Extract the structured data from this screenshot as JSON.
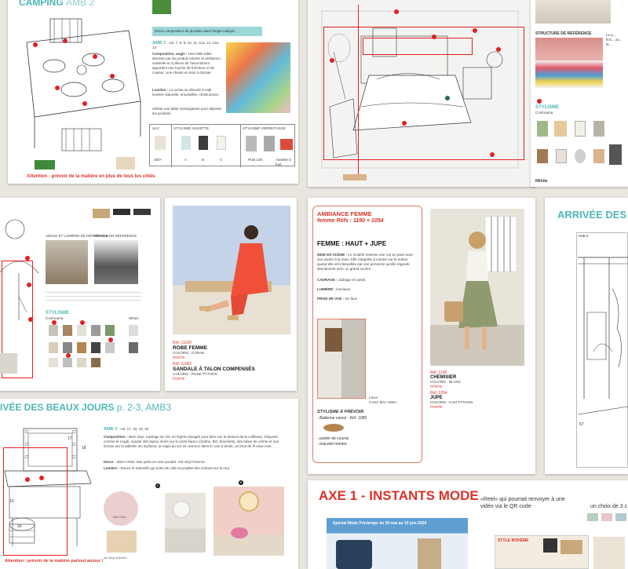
{
  "p1": {
    "title": "CAMPING",
    "title_suffix": "AMB 2",
    "banner": "Décor composition de produits dans l'angle indiqué",
    "amb_label": "AMB 2",
    "amb_vol": "- vol. 7, 8, 9, 10, 11, 11a, 12, 12a, 13",
    "composition_label": "Composition, angle :",
    "composition_text": "Une belle table dressée par du produit colorée et ambiance, vaisselle et 4 pièces de l'assortiment apportent une touche de fraîcheur et de couleur. Une chaise en bois à dossier.",
    "lumiere_label": "Lumière :",
    "lumiere_text": "La scène se déroule à midi, lumière naturelle, ensoleillée, chaleureuse.",
    "note": "Utiliser une table rectangulaire pour déposer les produits.",
    "warning": "Attention : prévoir de la matière en plus de tous les côtés",
    "table_headers": [
      "SAC",
      "STYLISME ASSIETTE",
      "STYLISME VERRE/TASSE"
    ],
    "table_values": [
      "300+",
      "A",
      "B",
      "C",
      "PUB 239",
      "Assiette à fruit"
    ]
  },
  "p2": {
    "struct_label": "STRUCTURE DE RÉFÉRENCE",
    "side_text": "Le p... fich... au... lit...",
    "stylisme_label": "STYLISME",
    "stylisme_sub": "Conforama",
    "nfinite_label": "Nfinite"
  },
  "p3": {
    "ref_label": "ANGLE ET LUMIÈRE DE RÉFÉRENCE",
    "structure_label": "RÉGION DE RÉFÉRENCE",
    "stylisme_label": "STYLISME",
    "stylisme_sub": "Conforama",
    "wholo_label": "Wholo"
  },
  "p4": {
    "product1_ref": "Réf. 11190",
    "product1_name": "ROBE FEMME",
    "product1_colors": "COLORIS : CORAIL",
    "product1_tag": "PORTÉ",
    "product2_ref": "Réf. 11002",
    "product2_name": "SANDALE À TALON COMPENSÉS",
    "product2_colors": "COLORIS : ROSE PYTHON",
    "product2_tag": "PORTÉ"
  },
  "p5": {
    "title": "AMBIANCE FEMME",
    "refs": "femme Réfs : 1190 + 1054",
    "heading": "FEMME : HAUT + JUPE",
    "mise_label": "MISE EN SCÈNE :",
    "mise_text": "Le modèle traverse une rue en pavé avec son panier à la main. Elle s'apprête à monter sur le trottoir quand elle est interpellée par une personne qu'elle regarde directement avec un grand sourire.",
    "cadrage_label": "CADRAGE :",
    "cadrage_text": "cadrage en pieds",
    "lumiere_label": "LUMIÈRE :",
    "lumiere_text": "lumineux",
    "prise_label": "PRISE DE VUE :",
    "prise_text": "De face",
    "stylisme_label": "STYLISME À PRÉVOIR",
    "stylisme_item1": "- Ballerine camel : Réf. 1085",
    "stylisme_item2": "- panier de course",
    "stylisme_item3": "- bracelet montre",
    "photo_label": "Lieux :",
    "photo_place": "CASC BAY AREA",
    "product1_ref": "Réf. 1190",
    "product1_name": "CHEMISIER",
    "product1_colors": "COLORIS : BLANC",
    "product1_tag": "PORTÉ",
    "product2_ref": "Réf. 1054",
    "product2_name": "JUPE",
    "product2_colors": "COLORIS : KAKI PYTHON",
    "product2_tag": "PORTÉ"
  },
  "p6": {
    "title": "ARRIVÉE DES",
    "amb_label": "AMB 8",
    "number": "67"
  },
  "p7": {
    "title": "IVÉE DES BEAUX JOURS",
    "title_pages": "p. 2-3, AMB3",
    "amb_label": "AMB 3",
    "amb_vol": "- vol. 17, 18, 19, 20",
    "composition_label": "Composition :",
    "composition_text": "Idem insp. Cadrage de 3/4, en légère plongée pour bien voir le dessus de la coiffeuse. Disposer comme le rough. Ajouter des bijoux dorés sur le porte-bijoux (chaîne, BO, bracelets), des tubes de crème et une brosse sur la tablette. En stylisme, un tapis au sol. En amorce dans le coin à droite, un bout de fil vase rose.",
    "decor_label": "Décor :",
    "decor_text": "Idem Amb2. Mur peint en rose poudré. Sol vinyl chevron.",
    "lumiere_label": "Lumière :",
    "lumiere_text": "Douce et naturelle qui entre de côté et projette des ombres sur le mur.",
    "swatch1_label": "RAL1164",
    "swatch2_label": "sol vinyl chevron",
    "warning": "Attention : prévoir de la matière partout autour !",
    "num_17": "17",
    "num_18": "18",
    "num_19": "19",
    "num_20": "20",
    "marker_a": "A",
    "marker_b": "B"
  },
  "p8": {
    "title": "AXE 1 - INSTANTS MODE",
    "promo_text": "Spécial Mode Printemps du 30 mai au 10 juin 2024",
    "reel_text": "«Reel» qui pourrait renvoyer à une vidéo via le QR code",
    "choice_text": "un choix de 3 c",
    "style_text": "STYLE BOHÈME"
  },
  "colors": {
    "teal": "#4db7b6",
    "red": "#d9332b",
    "coral": "#f0503a",
    "pink": "#e6c6c7",
    "sage": "#b7cdbd"
  }
}
